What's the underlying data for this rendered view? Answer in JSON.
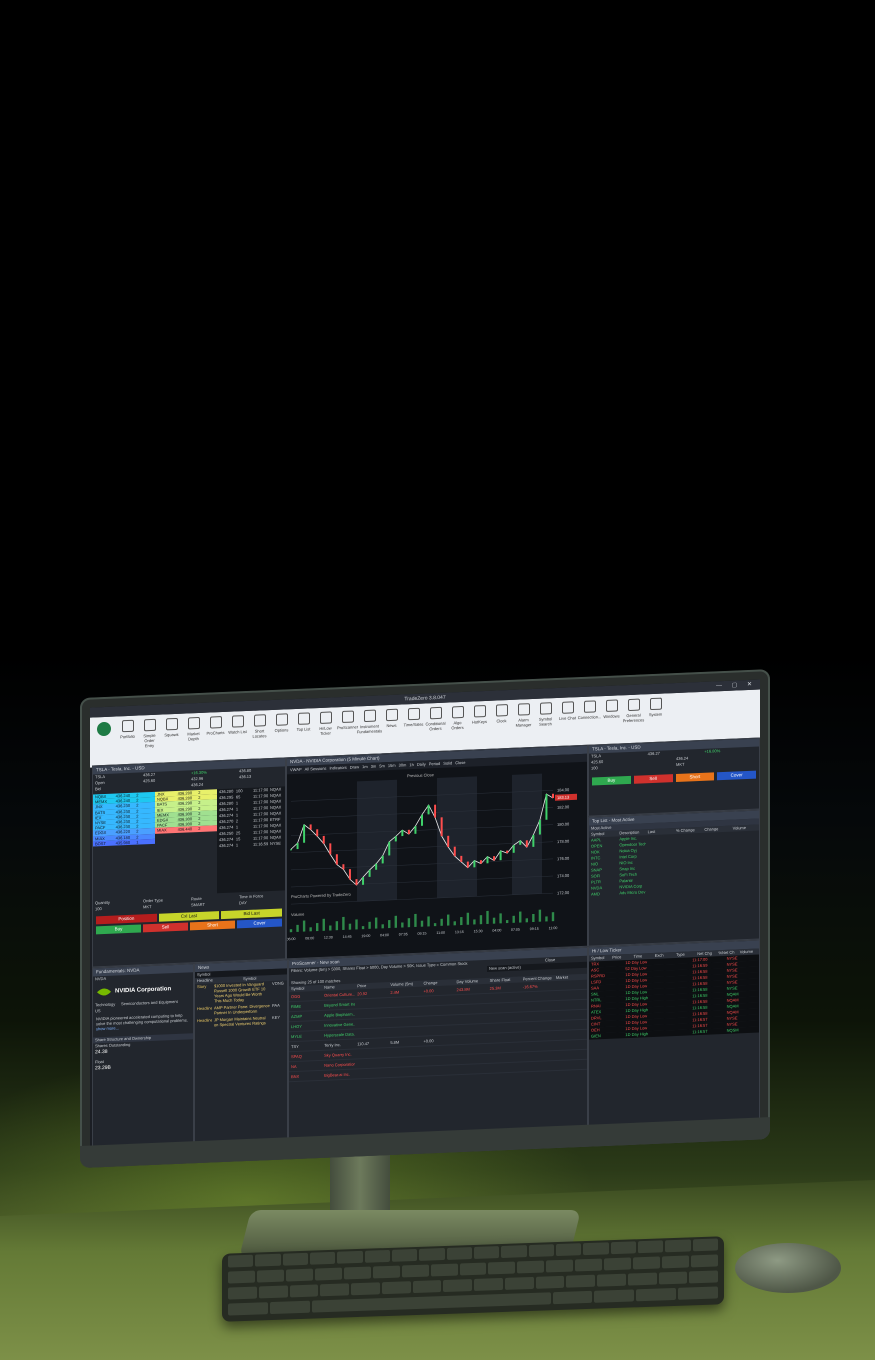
{
  "app": {
    "title": "TradeZero 3.8.047",
    "window_controls": "— ▢ ✕",
    "ribbon": [
      {
        "label": "Portfolio",
        "icon": "briefcase-icon"
      },
      {
        "label": "Simple Order Entry",
        "icon": "order-icon"
      },
      {
        "label": "Squawk",
        "icon": "squawk-icon"
      },
      {
        "label": "Market Depth",
        "icon": "depth-icon"
      },
      {
        "label": "ProCharts",
        "icon": "chart-icon"
      },
      {
        "label": "Watch List",
        "icon": "star-icon"
      },
      {
        "label": "Short Locates",
        "icon": "short-icon"
      },
      {
        "label": "Options",
        "icon": "options-icon"
      },
      {
        "label": "Top List",
        "icon": "toplist-icon"
      },
      {
        "label": "Hi/Low Ticker",
        "icon": "hilow-icon"
      },
      {
        "label": "ProScanner",
        "icon": "scanner-icon"
      },
      {
        "label": "Instrument Fundamentals",
        "icon": "fundamentals-icon"
      },
      {
        "label": "News",
        "icon": "news-icon"
      },
      {
        "label": "Time/Sales",
        "icon": "hourglass-icon"
      },
      {
        "label": "Conditional Orders",
        "icon": "conditional-icon"
      },
      {
        "label": "Algo Orders",
        "icon": "algo-icon"
      },
      {
        "label": "HotKeys",
        "icon": "hotkeys-icon"
      },
      {
        "label": "Clock",
        "icon": "clock-icon"
      },
      {
        "label": "Alarm Manager",
        "icon": "bell-icon"
      },
      {
        "label": "Symbol Search",
        "icon": "search-icon"
      },
      {
        "label": "Live Chat",
        "icon": "chat-icon"
      },
      {
        "label": "Connection...",
        "icon": "connection-icon"
      },
      {
        "label": "Windows",
        "icon": "windows-icon"
      },
      {
        "label": "General Preferences",
        "icon": "sliders-icon"
      },
      {
        "label": "System",
        "icon": "monitor-icon"
      }
    ]
  },
  "montage": {
    "title": "TSLA - Tesla, Inc. - USD",
    "symbol": "TSLA",
    "last": "436.27",
    "change": "+16.30%",
    "open_label": "Open",
    "open": "425.60",
    "bid_label": "Bid",
    "bid": "436.24",
    "high": "432.96",
    "low": "436.13",
    "vwap": "436.80",
    "levels_bid": [
      {
        "mm": "NQBX",
        "px": "436.240",
        "sz": "2"
      },
      {
        "mm": "MEMX",
        "px": "436.240",
        "sz": "2"
      },
      {
        "mm": "JNX",
        "px": "436.230",
        "sz": "2"
      },
      {
        "mm": "BATS",
        "px": "436.230",
        "sz": "2"
      },
      {
        "mm": "IEX",
        "px": "436.230",
        "sz": "2"
      },
      {
        "mm": "NYSE",
        "px": "436.230",
        "sz": "2"
      },
      {
        "mm": "PACF",
        "px": "436.230",
        "sz": "2"
      },
      {
        "mm": "EDGX",
        "px": "436.220",
        "sz": "2"
      },
      {
        "mm": "MIAX",
        "px": "436.180",
        "sz": "2"
      },
      {
        "mm": "BOST",
        "px": "435.980",
        "sz": "1"
      }
    ],
    "levels_ask": [
      {
        "mm": "JNX",
        "px": "436.280",
        "sz": "2"
      },
      {
        "mm": "NQBX",
        "px": "436.280",
        "sz": "2"
      },
      {
        "mm": "BATS",
        "px": "436.290",
        "sz": "2"
      },
      {
        "mm": "IEX",
        "px": "436.290",
        "sz": "2"
      },
      {
        "mm": "MEMX",
        "px": "436.300",
        "sz": "2"
      },
      {
        "mm": "EDGX",
        "px": "436.300",
        "sz": "2"
      },
      {
        "mm": "PACF",
        "px": "436.300",
        "sz": "2"
      },
      {
        "mm": "MIAX",
        "px": "436.440",
        "sz": "2"
      }
    ],
    "prints": [
      {
        "px": "436.280",
        "sz": "100",
        "t": "11:17:00",
        "ex": "NQAX"
      },
      {
        "px": "436.295",
        "sz": "65",
        "t": "11:17:00",
        "ex": "NQAX"
      },
      {
        "px": "436.280",
        "sz": "1",
        "t": "11:17:00",
        "ex": "NQAX"
      },
      {
        "px": "436.274",
        "sz": "1",
        "t": "11:17:00",
        "ex": "NQAX"
      },
      {
        "px": "436.274",
        "sz": "1",
        "t": "11:17:00",
        "ex": "NQAX"
      },
      {
        "px": "436.270",
        "sz": "2",
        "t": "11:17:00",
        "ex": "ETRF"
      },
      {
        "px": "436.274",
        "sz": "1",
        "t": "11:17:00",
        "ex": "NQAX"
      },
      {
        "px": "436.250",
        "sz": "25",
        "t": "11:17:00",
        "ex": "NQAX"
      },
      {
        "px": "436.274",
        "sz": "15",
        "t": "11:17:00",
        "ex": "NQAX"
      },
      {
        "px": "436.274",
        "sz": "1",
        "t": "11:16:59",
        "ex": "NYSE"
      }
    ],
    "quantity_label": "Quantity",
    "quantity": "100",
    "order_type_label": "Order Type",
    "order_type": "MKT",
    "route_label": "Route",
    "route": "SMART",
    "tif_label": "Time in Force",
    "tif": "DAY",
    "buttons": {
      "position": "Position",
      "cxl_last": "Cxl Last",
      "bid_last": "Bid Last",
      "buy": "Buy",
      "sell": "Sell",
      "short": "Short",
      "cover": "Cover"
    }
  },
  "chart": {
    "title": "NVDA - NVIDIA Corporation (5 Minute Chart)",
    "toolbar": [
      "VWAP",
      "All Sessions",
      "Indicators",
      "Draw",
      "1m",
      "3m",
      "5m",
      "15m",
      "30m",
      "1h",
      "Daily",
      "Period"
    ],
    "solid_label": "Solid",
    "close_label": "Close",
    "previous_close_label": "Previous Close",
    "watermark": "ProCharts Powered by TradeZero",
    "volume_label": "Volume",
    "price_ticks": [
      "184.00",
      "182.00",
      "180.00",
      "178.00",
      "176.00",
      "174.00",
      "172.00"
    ],
    "last_price": "183.13",
    "time_ticks": [
      "06:00",
      "08:00",
      "12:30",
      "14:45",
      "19:00",
      "04:00",
      "07:05",
      "09:15",
      "11:00",
      "13:15",
      "15:30",
      "04:00",
      "07:05",
      "09:15",
      "11:00"
    ],
    "chart_data": {
      "type": "line",
      "x": [
        0,
        1,
        2,
        3,
        4,
        5,
        6,
        7,
        8,
        9,
        10,
        11,
        12,
        13,
        14,
        15,
        16,
        17,
        18,
        19,
        20,
        21,
        22,
        23,
        24,
        25,
        26,
        27,
        28,
        29,
        30,
        31,
        32,
        33,
        34,
        35,
        36,
        37,
        38,
        39,
        40
      ],
      "values": [
        178.4,
        179.1,
        181.2,
        180.6,
        179.8,
        178.9,
        177.6,
        176.4,
        175.8,
        174.6,
        173.9,
        174.8,
        175.6,
        176.3,
        177.2,
        178.8,
        179.4,
        180.1,
        179.6,
        180.5,
        181.8,
        182.9,
        181.4,
        179.2,
        177.9,
        176.8,
        176.1,
        175.4,
        176.2,
        175.8,
        176.6,
        176.1,
        177.2,
        176.9,
        177.8,
        178.3,
        177.5,
        178.9,
        180.6,
        183.6,
        183.1
      ],
      "ylim": [
        172,
        186
      ]
    }
  },
  "montage2": {
    "title": "TSLA - Tesla, Inc. - USD",
    "symbol": "TSLA",
    "last": "436.27",
    "change": "+16.80%",
    "open": "425.60",
    "bid": "436.24",
    "quantity": "100",
    "order_type": "MKT",
    "buttons": {
      "buy": "Buy",
      "sell": "Sell",
      "short": "Short",
      "cover": "Cover"
    }
  },
  "toplist": {
    "title": "Top List - Most Active",
    "mode": "Most Active",
    "columns": [
      "Symbol",
      "Description",
      "Last",
      "% Change",
      "Change",
      "Volume"
    ],
    "rows": [
      {
        "sym": "AAPL",
        "desc": "Apple Inc.",
        "last": "",
        "pct": "",
        "chg": "",
        "vol": ""
      },
      {
        "sym": "OPEN",
        "desc": "Opendoor Tech",
        "last": "",
        "pct": "",
        "chg": "",
        "vol": ""
      },
      {
        "sym": "NOK",
        "desc": "Nokia Oyj",
        "last": "",
        "pct": "",
        "chg": "",
        "vol": ""
      },
      {
        "sym": "INTC",
        "desc": "Intel Corp",
        "last": "",
        "pct": "",
        "chg": "",
        "vol": ""
      },
      {
        "sym": "NIO",
        "desc": "NIO Inc",
        "last": "",
        "pct": "",
        "chg": "",
        "vol": ""
      },
      {
        "sym": "SNAP",
        "desc": "Snap Inc",
        "last": "",
        "pct": "",
        "chg": "",
        "vol": ""
      },
      {
        "sym": "SOFI",
        "desc": "SoFi Tech",
        "last": "",
        "pct": "",
        "chg": "",
        "vol": ""
      },
      {
        "sym": "PLTR",
        "desc": "Palantir",
        "last": "",
        "pct": "",
        "chg": "",
        "vol": ""
      },
      {
        "sym": "NVDA",
        "desc": "NVIDIA Corp",
        "last": "",
        "pct": "",
        "chg": "",
        "vol": ""
      },
      {
        "sym": "AMD",
        "desc": "Adv Micro Dev",
        "last": "",
        "pct": "",
        "chg": "",
        "vol": ""
      }
    ]
  },
  "fundamentals": {
    "title": "Fundamentals: NVDA",
    "symbol": "NVDA",
    "company": "NVIDIA Corporation",
    "sector": "Technology",
    "industry": "Semiconductors and Equipment",
    "country": "US",
    "blurb": "NVIDIA pioneered accelerated computing to help solve the most challenging computational problems.",
    "more": "show more...",
    "section": "Share Structure and Ownership",
    "shares_outstanding_label": "Shares Outstanding",
    "shares_outstanding": "24.38",
    "float_label": "Float",
    "float": "23.29B"
  },
  "news": {
    "title": "News",
    "symbol_placeholder": "Symbol",
    "columns": [
      "Headline",
      "Symbol"
    ],
    "items": [
      {
        "type": "Story",
        "headline": "$1000 Invested In Vanguard Russell 1000 Growth ETF 10 Years Ago Would Be Worth This Much Today",
        "sym": "VONG"
      },
      {
        "type": "Headline",
        "headline": "AMP Partner Pane: Divergence Partner In Underperform",
        "sym": "PAA"
      },
      {
        "type": "Headline",
        "headline": "JP Morgan Maintains Neutral on Spectral Ventures Ratings",
        "sym": "KEY"
      }
    ]
  },
  "scanner": {
    "title": "ProScanner - New scan",
    "filters": "Filters: Volume (5m) > 5000, Shares Float > 5000, Day Volume > 50K, Issue Type = Common Stock",
    "new_scan": "New scan (active)",
    "close_label": "Close",
    "showing": "Showing 25 of 100 matches",
    "columns": [
      "Symbol",
      "Name",
      "Price",
      "Volume (5m)",
      "Change",
      "Day Volume",
      "Share Float",
      "Percent Change",
      "Market"
    ],
    "rows": [
      {
        "sym": "OGG",
        "name": "Oriental Culture...",
        "px": "20.92",
        "v5": "2.4M",
        "chg": "+0.00",
        "dv": "243.8M",
        "sf": "25.3M",
        "pc": "-16.67%",
        "cls": "r"
      },
      {
        "sym": "RIME",
        "name": "Beyond Smart Inc.",
        "px": "",
        "v5": "",
        "chg": "",
        "dv": "",
        "sf": "",
        "pc": "",
        "cls": "g"
      },
      {
        "sym": "AZMP",
        "name": "Apple Biopharm...",
        "px": "",
        "v5": "",
        "chg": "",
        "dv": "",
        "sf": "",
        "pc": "",
        "cls": "g"
      },
      {
        "sym": "LHOY",
        "name": "Innovative Gene...",
        "px": "",
        "v5": "",
        "chg": "",
        "dv": "",
        "sf": "",
        "pc": "",
        "cls": "g"
      },
      {
        "sym": "MYLE",
        "name": "Hyperscale Data...",
        "px": "",
        "v5": "",
        "chg": "",
        "dv": "",
        "sf": "",
        "pc": "",
        "cls": "g"
      },
      {
        "sym": "TSY",
        "name": "Tenly Inc.",
        "px": "110.47",
        "v5": "5.8M",
        "chg": "+0.00",
        "dv": "",
        "sf": "",
        "pc": "",
        "cls": "w"
      },
      {
        "sym": "SPAQ",
        "name": "Sky Quarry Inc.",
        "px": "",
        "v5": "",
        "chg": "",
        "dv": "",
        "sf": "",
        "pc": "",
        "cls": "r"
      },
      {
        "sym": "NA",
        "name": "Nano Corporation",
        "px": "",
        "v5": "",
        "chg": "",
        "dv": "",
        "sf": "",
        "pc": "",
        "cls": "r"
      },
      {
        "sym": "BNX",
        "name": "BigBear.ai Inc.",
        "px": "",
        "v5": "",
        "chg": "",
        "dv": "",
        "sf": "",
        "pc": "",
        "cls": "r"
      }
    ]
  },
  "hilow": {
    "title": "Hi / Low Ticker",
    "columns": [
      "Symbol",
      "Price",
      "Time",
      "Exch",
      "Type",
      "Net Chg",
      "%Net Ch",
      "Volume"
    ],
    "rows": [
      {
        "sym": "TRX",
        "t": "1D Day Low",
        "tm": "11:17:00",
        "ex": "NYSE",
        "cls": "r"
      },
      {
        "sym": "ASC",
        "t": "52 Day Low",
        "tm": "11:16:59",
        "ex": "NYSE",
        "cls": "r"
      },
      {
        "sym": "RSPRD",
        "t": "1D Day Low",
        "tm": "11:16:58",
        "ex": "NYSE",
        "cls": "r"
      },
      {
        "sym": "LSFD",
        "t": "1D Day Low",
        "tm": "11:16:58",
        "ex": "NYSE",
        "cls": "r"
      },
      {
        "sym": "SAA",
        "t": "1D Day Low",
        "tm": "11:16:58",
        "ex": "NYSE",
        "cls": "r"
      },
      {
        "sym": "SNL",
        "t": "1D Day Low",
        "tm": "11:16:58",
        "ex": "NYSE",
        "cls": "g"
      },
      {
        "sym": "NTRL",
        "t": "1D Day High",
        "tm": "11:16:58",
        "ex": "NQAM",
        "cls": "g"
      },
      {
        "sym": "RNAI",
        "t": "1D Day Low",
        "tm": "11:16:58",
        "ex": "NQAM",
        "cls": "r"
      },
      {
        "sym": "ATEX",
        "t": "1D Day High",
        "tm": "11:16:58",
        "ex": "NQAM",
        "cls": "g"
      },
      {
        "sym": "DRVL",
        "t": "1D Day Low",
        "tm": "11:16:58",
        "ex": "NQAM",
        "cls": "r"
      },
      {
        "sym": "CINT",
        "t": "1D Day Low",
        "tm": "11:16:57",
        "ex": "NYSE",
        "cls": "r"
      },
      {
        "sym": "OEH",
        "t": "1D Day Low",
        "tm": "11:16:57",
        "ex": "NYSE",
        "cls": "r"
      },
      {
        "sym": "GIEN",
        "t": "1D Day High",
        "tm": "11:16:57",
        "ex": "NQSM",
        "cls": "g"
      }
    ]
  },
  "colors": {
    "buy": "#2fa84f",
    "sell": "#d0312d",
    "short": "#e8731a",
    "cover": "#2456c7",
    "cxl": "#c7d52a",
    "position": "#b51d1d"
  }
}
